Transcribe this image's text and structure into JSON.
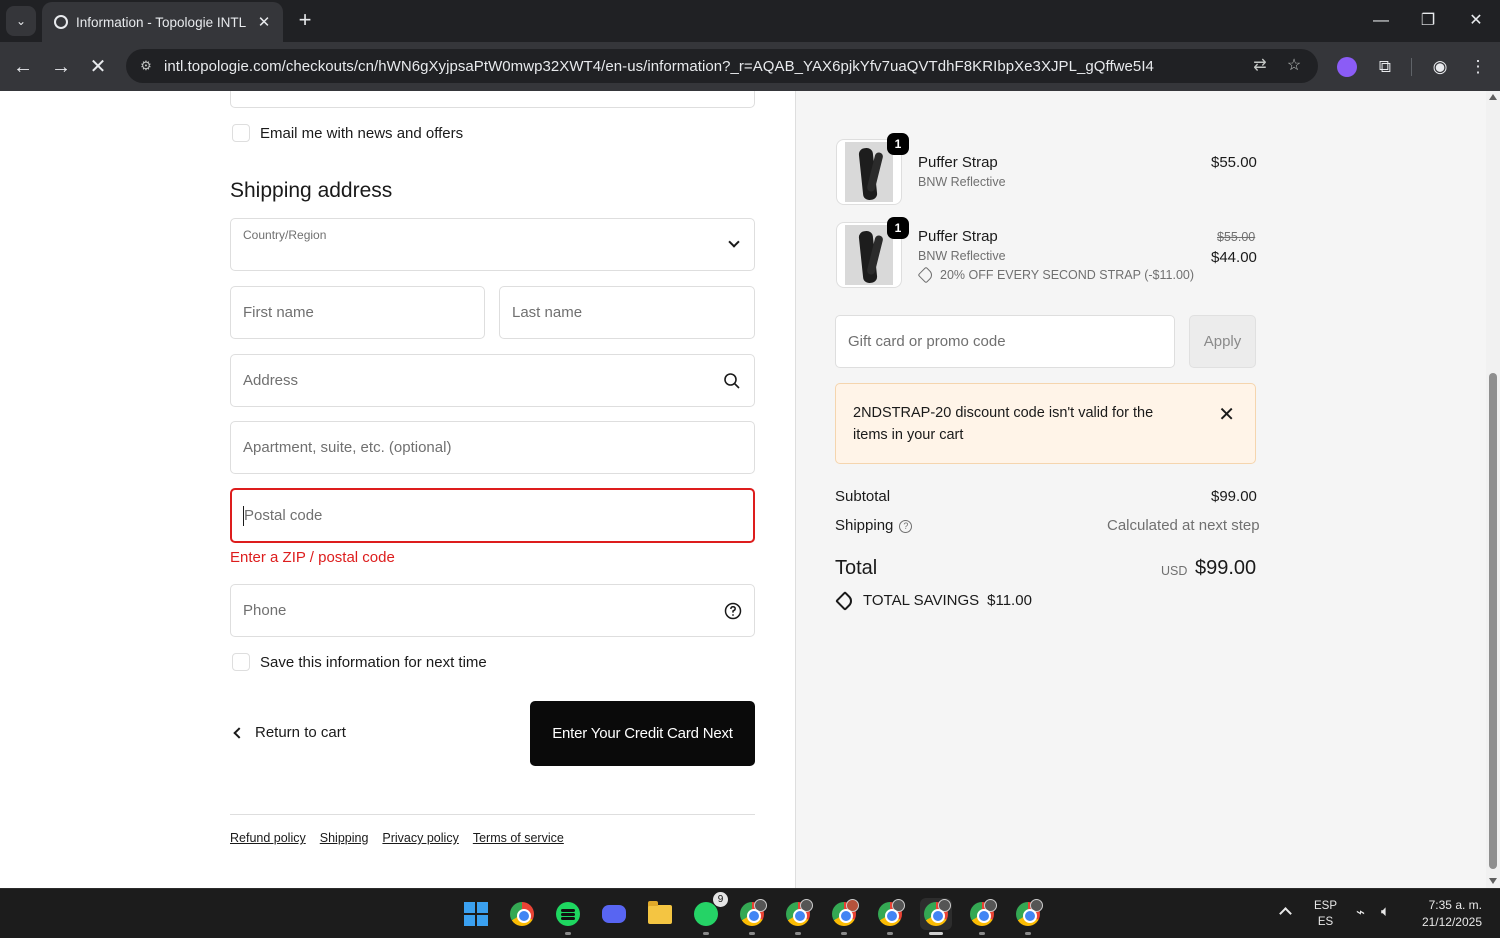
{
  "browser": {
    "tab_title": "Information - Topologie INTL - C",
    "url": "intl.topologie.com/checkouts/cn/hWN6gXyjpsaPtW0mwp32XWT4/en-us/information?_r=AQAB_YAX6pjkYfv7uaQVTdhF8KRIbpXe3XJPL_gQffwe5I4"
  },
  "form": {
    "email_optin_label": "Email me with news and offers",
    "shipping_title": "Shipping address",
    "country_label": "Country/Region",
    "first_name_placeholder": "First name",
    "last_name_placeholder": "Last name",
    "address_placeholder": "Address",
    "apartment_placeholder": "Apartment, suite, etc. (optional)",
    "postal_placeholder": "Postal code",
    "postal_error": "Enter a ZIP / postal code",
    "phone_placeholder": "Phone",
    "save_info_label": "Save this information for next time",
    "return_label": "Return to cart",
    "continue_label": "Enter Your Credit Card Next"
  },
  "footer": {
    "links": [
      "Refund policy",
      "Shipping",
      "Privacy policy",
      "Terms of service"
    ]
  },
  "summary": {
    "items": [
      {
        "qty": "1",
        "name": "Puffer Strap",
        "variant": "BNW Reflective",
        "price": "$55.00"
      },
      {
        "qty": "1",
        "name": "Puffer Strap",
        "variant": "BNW Reflective",
        "old_price": "$55.00",
        "price": "$44.00",
        "discount": "20% OFF EVERY SECOND STRAP (-$11.00)"
      }
    ],
    "promo_placeholder": "Gift card or promo code",
    "apply_label": "Apply",
    "notice": "2NDSTRAP-20 discount code isn't valid for the items in your cart",
    "subtotal_label": "Subtotal",
    "subtotal_value": "$99.00",
    "shipping_label": "Shipping",
    "shipping_value": "Calculated at next step",
    "total_label": "Total",
    "currency": "USD",
    "total_value": "$99.00",
    "savings_label": "TOTAL SAVINGS",
    "savings_value": "$11.00"
  },
  "taskbar": {
    "lang_top": "ESP",
    "lang_bottom": "ES",
    "time": "7:35 a. m.",
    "date": "21/12/2025",
    "whatsapp_badge": "9"
  }
}
